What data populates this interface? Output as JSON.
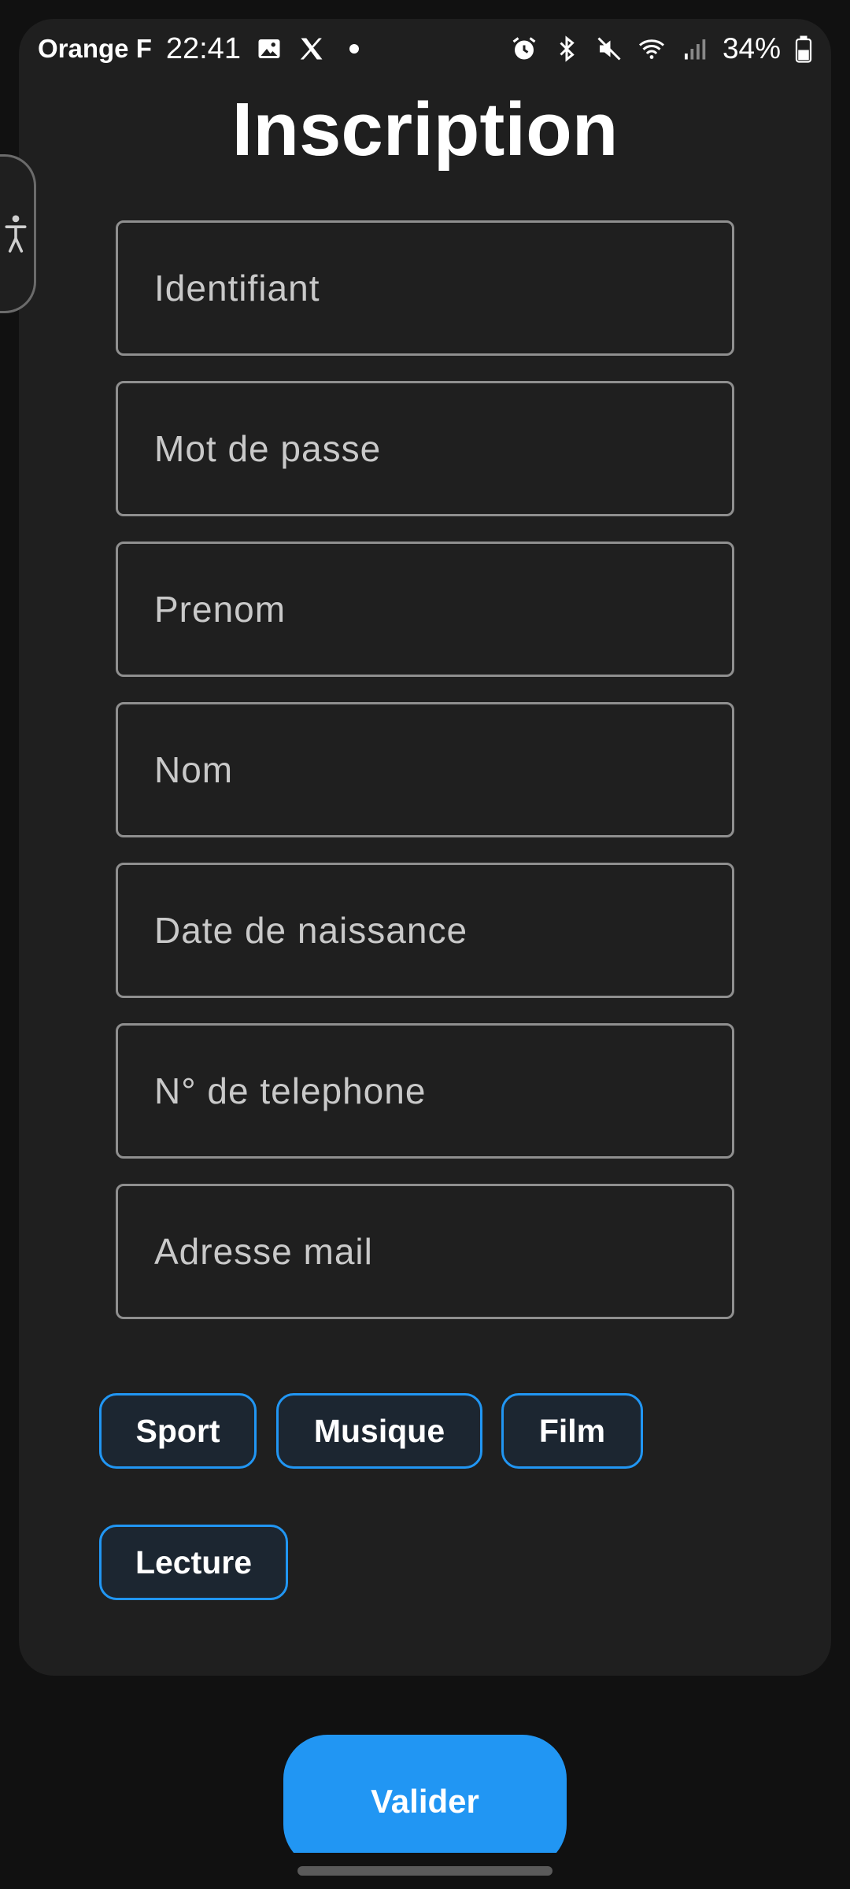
{
  "status_bar": {
    "carrier": "Orange F",
    "time": "22:41",
    "battery": "34%",
    "icons_left": [
      "image-icon",
      "x-logo-icon",
      "dot-icon"
    ],
    "icons_right": [
      "alarm-icon",
      "bluetooth-icon",
      "mute-icon",
      "wifi-icon",
      "signal-icon",
      "battery-icon"
    ]
  },
  "page": {
    "title": "Inscription"
  },
  "form": {
    "fields": [
      {
        "name": "username",
        "placeholder": "Identifiant",
        "value": ""
      },
      {
        "name": "password",
        "placeholder": "Mot de passe",
        "value": ""
      },
      {
        "name": "firstname",
        "placeholder": "Prenom",
        "value": ""
      },
      {
        "name": "lastname",
        "placeholder": "Nom",
        "value": ""
      },
      {
        "name": "birthdate",
        "placeholder": "Date de naissance",
        "value": ""
      },
      {
        "name": "phone",
        "placeholder": "N° de telephone",
        "value": ""
      },
      {
        "name": "email",
        "placeholder": "Adresse mail",
        "value": ""
      }
    ],
    "interests": [
      "Sport",
      "Musique",
      "Film",
      "Lecture"
    ],
    "submit_label": "Valider"
  },
  "colors": {
    "background": "#111111",
    "card": "#1f1f1f",
    "accent": "#2196f3",
    "field_border": "#8f8f8f"
  }
}
